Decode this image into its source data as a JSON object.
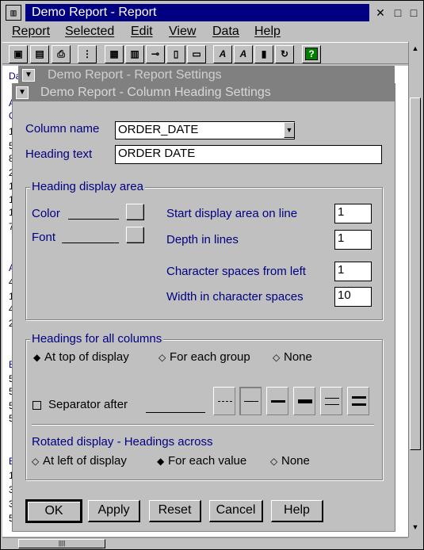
{
  "app": {
    "title": "Demo Report - Report",
    "sys_icon": "▥"
  },
  "titlebar_buttons": {
    "close": "✕",
    "minimize": "□",
    "maximize": "□"
  },
  "menu": [
    "Report",
    "Selected",
    "Edit",
    "View",
    "Data",
    "Help"
  ],
  "toolbar_icons": [
    "save-icon",
    "open-icon",
    "print-icon",
    "settings-icon",
    "table-icon",
    "form-icon",
    "key-icon",
    "report-icon",
    "layout-icon",
    "font-a-icon",
    "font-a-italic-icon",
    "page-icon",
    "refresh-icon",
    "help-icon"
  ],
  "toolbar_glyphs": [
    "▣",
    "▤",
    "⎙",
    "⋮",
    "▦",
    "▥",
    "⊸",
    "▯",
    "▭",
    "A",
    "A",
    "▮",
    "↻",
    "?"
  ],
  "background_text": {
    "chars": [
      "Da",
      "A",
      "O",
      "1",
      "5",
      "8",
      "2",
      "1",
      "1",
      "1",
      "7",
      "A",
      "4",
      "1",
      "4",
      "2",
      "E",
      "5",
      "5",
      "5",
      "5",
      "E",
      "1",
      "3",
      "3",
      "5"
    ]
  },
  "report_settings": {
    "title": "Demo Report - Report Settings"
  },
  "dialog": {
    "title": "Demo Report - Column Heading Settings",
    "column_name_label": "Column name",
    "column_name_value": "ORDER_DATE",
    "heading_text_label": "Heading text",
    "heading_text_value": "ORDER DATE",
    "heading_display_area": {
      "title": "Heading display area",
      "color_label": "Color",
      "font_label": "Font",
      "start_line_label": "Start display area on line",
      "start_line_value": "1",
      "depth_label": "Depth in lines",
      "depth_value": "1",
      "char_spaces_left_label": "Character spaces from left",
      "char_spaces_left_value": "1",
      "width_label": "Width in character spaces",
      "width_value": "10"
    },
    "headings_all_columns": {
      "title": "Headings for all columns",
      "options": [
        "At top of display",
        "For each group",
        "None"
      ],
      "selected": "At top of display",
      "separator_label": "Separator after"
    },
    "rotated_display": {
      "title": "Rotated display - Headings across",
      "options": [
        "At left of display",
        "For each value",
        "None"
      ],
      "selected": "For each value"
    },
    "buttons": {
      "ok": "OK",
      "apply": "Apply",
      "reset": "Reset",
      "cancel": "Cancel",
      "help": "Help"
    }
  },
  "colors": {
    "title_active": "#000080",
    "title_inactive": "#808080",
    "label": "#000080",
    "face": "#c0c0c0"
  }
}
